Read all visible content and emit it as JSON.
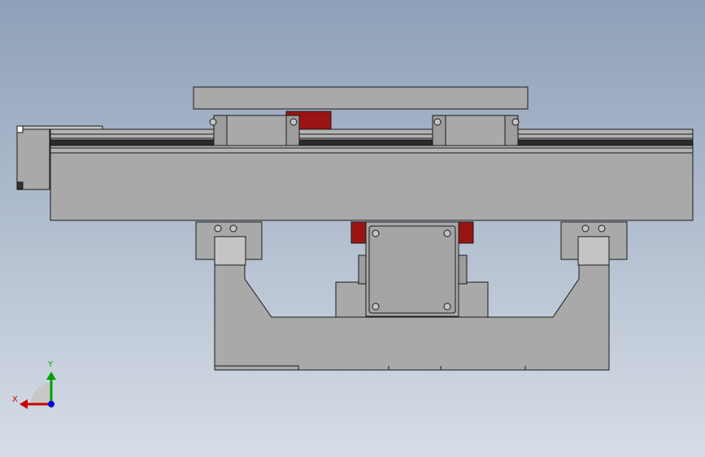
{
  "viewport": {
    "background_top": "#8ea0b8",
    "background_bottom": "#d6dde6"
  },
  "triad": {
    "x_label": "X",
    "y_label": "Y",
    "x_color": "#cc0000",
    "y_color": "#00a000",
    "z_color": "#0000dd"
  },
  "colors": {
    "body_gray": "#a9a9a9",
    "dark_gray": "#7d7d7d",
    "light_gray": "#c4c4c4",
    "red_part": "#9a1414",
    "outline": "#1a1a1a"
  }
}
